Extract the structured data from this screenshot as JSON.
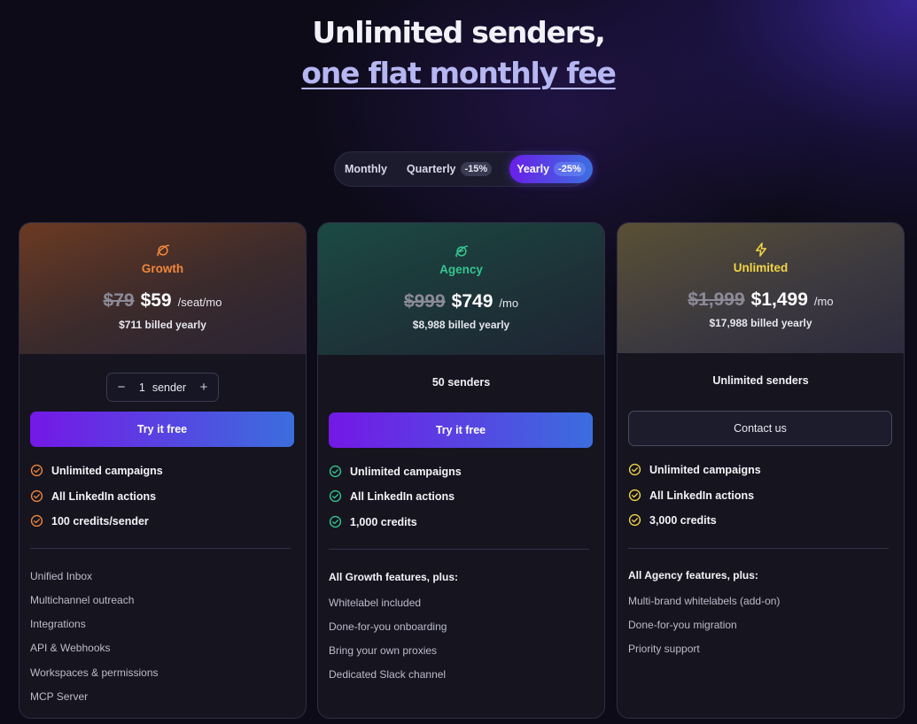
{
  "hero": {
    "line1": "Unlimited senders,",
    "line2": "one flat monthly fee"
  },
  "billing_toggle": {
    "monthly": "Monthly",
    "quarterly": "Quarterly",
    "quarterly_badge": "-15%",
    "yearly": "Yearly",
    "yearly_badge": "-25%",
    "selected": "Yearly"
  },
  "colors": {
    "growth": "#f0873c",
    "agency": "#34c58f",
    "unlimited": "#f2d449",
    "cta_from": "#7418e6",
    "cta_to": "#3b6ede"
  },
  "plans": [
    {
      "icon": "planet-icon",
      "name": "Growth",
      "old_price": "$79",
      "price": "$59",
      "per": "/seat/mo",
      "billed": "$711 billed yearly",
      "stepper": {
        "minus": "−",
        "count": "1",
        "unit": "sender",
        "plus": "+"
      },
      "cta": "Try it free",
      "features": [
        "Unlimited campaigns",
        "All LinkedIn actions",
        "100 credits/sender"
      ],
      "extras_heading": "",
      "extras": [
        "Unified Inbox",
        "Multichannel outreach",
        "Integrations",
        "API & Webhooks",
        "Workspaces & permissions",
        "MCP Server"
      ]
    },
    {
      "icon": "planet-icon",
      "name": "Agency",
      "old_price": "$999",
      "price": "$749",
      "per": "/mo",
      "billed": "$8,988 billed yearly",
      "senders": "50 senders",
      "cta": "Try it free",
      "features": [
        "Unlimited campaigns",
        "All LinkedIn actions",
        "1,000 credits"
      ],
      "extras_heading": "All Growth features, plus:",
      "extras": [
        "Whitelabel included",
        "Done-for-you onboarding",
        "Bring your own proxies",
        "Dedicated Slack channel"
      ]
    },
    {
      "icon": "lightning-icon",
      "name": "Unlimited",
      "old_price": "$1,999",
      "price": "$1,499",
      "per": "/mo",
      "billed": "$17,988 billed yearly",
      "senders": "Unlimited senders",
      "cta": "Contact us",
      "features": [
        "Unlimited campaigns",
        "All LinkedIn actions",
        "3,000 credits"
      ],
      "extras_heading": "All Agency features, plus:",
      "extras": [
        "Multi-brand whitelabels (add-on)",
        "Done-for-you migration",
        "Priority support"
      ]
    }
  ]
}
